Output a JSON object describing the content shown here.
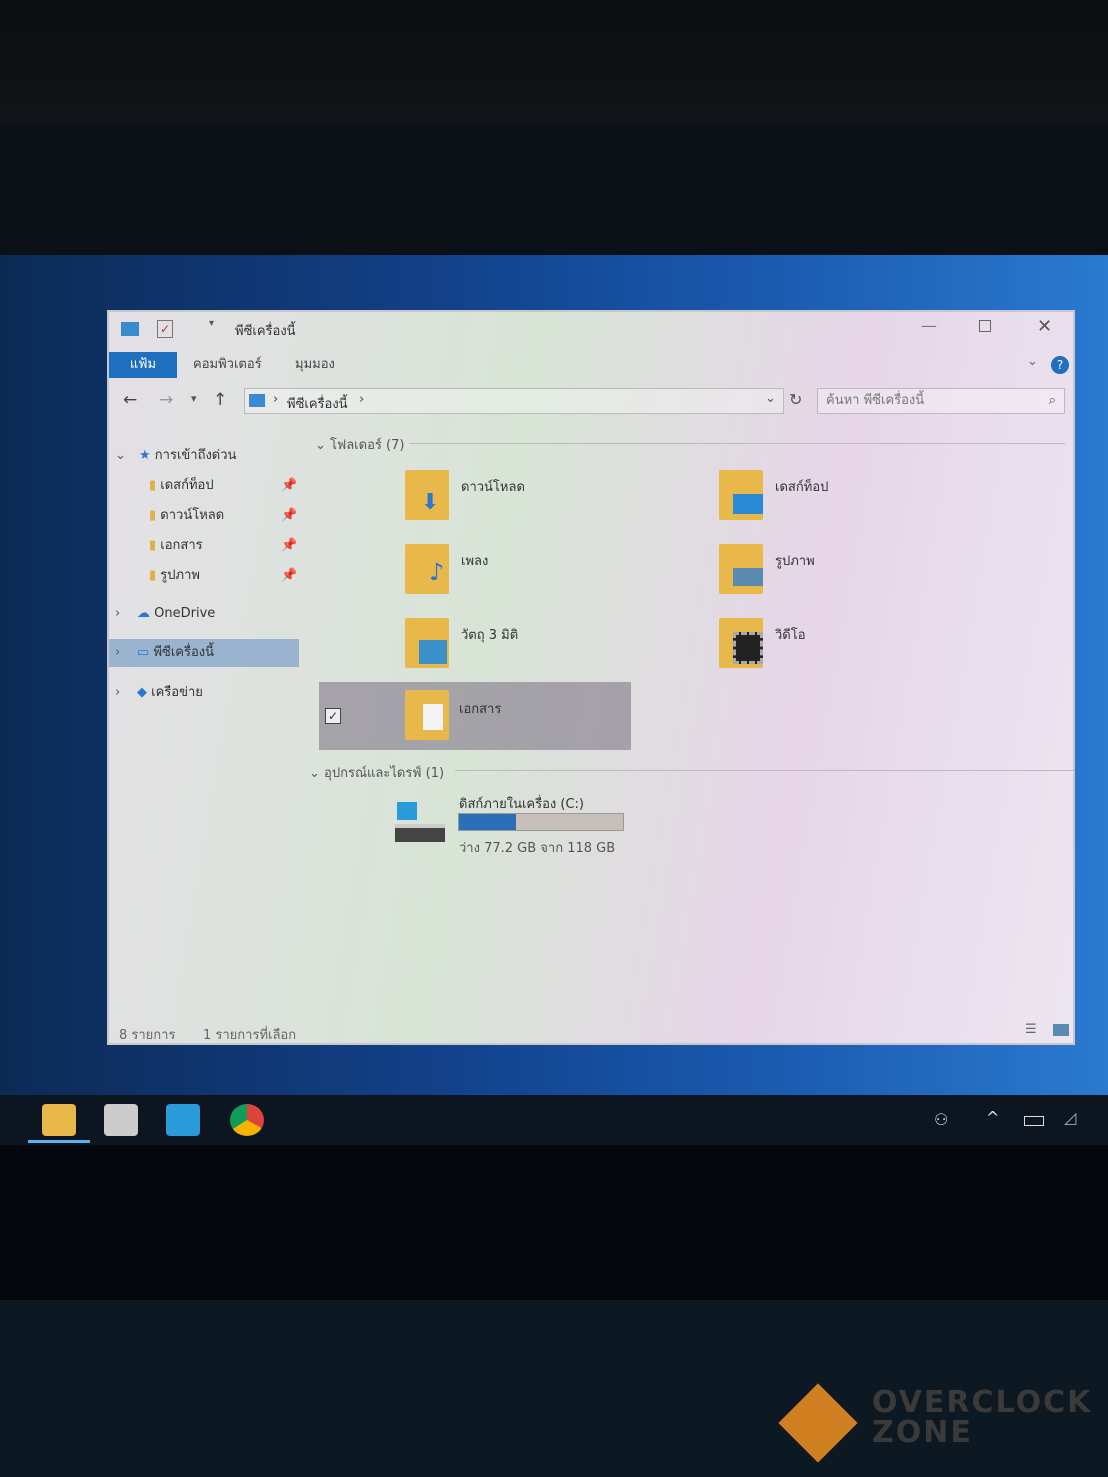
{
  "window": {
    "title": "พีซีเครื่องนี้",
    "tabs": [
      "แฟ้ม",
      "คอมพิวเตอร์",
      "มุมมอง"
    ],
    "help": "?"
  },
  "address": {
    "path": "พีซีเครื่องนี้",
    "search_placeholder": "ค้นหา พีซีเครื่องนี้"
  },
  "sidebar": {
    "items": [
      {
        "label": "การเข้าถึงด่วน"
      },
      {
        "label": "เดสก์ท็อป"
      },
      {
        "label": "ดาวน์โหลด"
      },
      {
        "label": "เอกสาร"
      },
      {
        "label": "รูปภาพ"
      },
      {
        "label": "OneDrive"
      },
      {
        "label": "พีซีเครื่องนี้"
      },
      {
        "label": "เครือข่าย"
      }
    ]
  },
  "groups": {
    "folders": "โฟลเดอร์ (7)",
    "devices": "อุปกรณ์และไดรฟ์ (1)"
  },
  "folders": [
    "ดาวน์โหลด",
    "เดสก์ท็อป",
    "เพลง",
    "รูปภาพ",
    "วัตถุ 3 มิติ",
    "วิดีโอ",
    "เอกสาร"
  ],
  "drive": {
    "name": "ดิสก์ภายในเครื่อง (C:)",
    "free_text": "ว่าง 77.2 GB จาก 118 GB",
    "used_fraction": 0.35
  },
  "status": {
    "count": "8 รายการ",
    "selected": "1 รายการที่เลือก"
  },
  "watermark": "OVERCLOCK ZONE"
}
